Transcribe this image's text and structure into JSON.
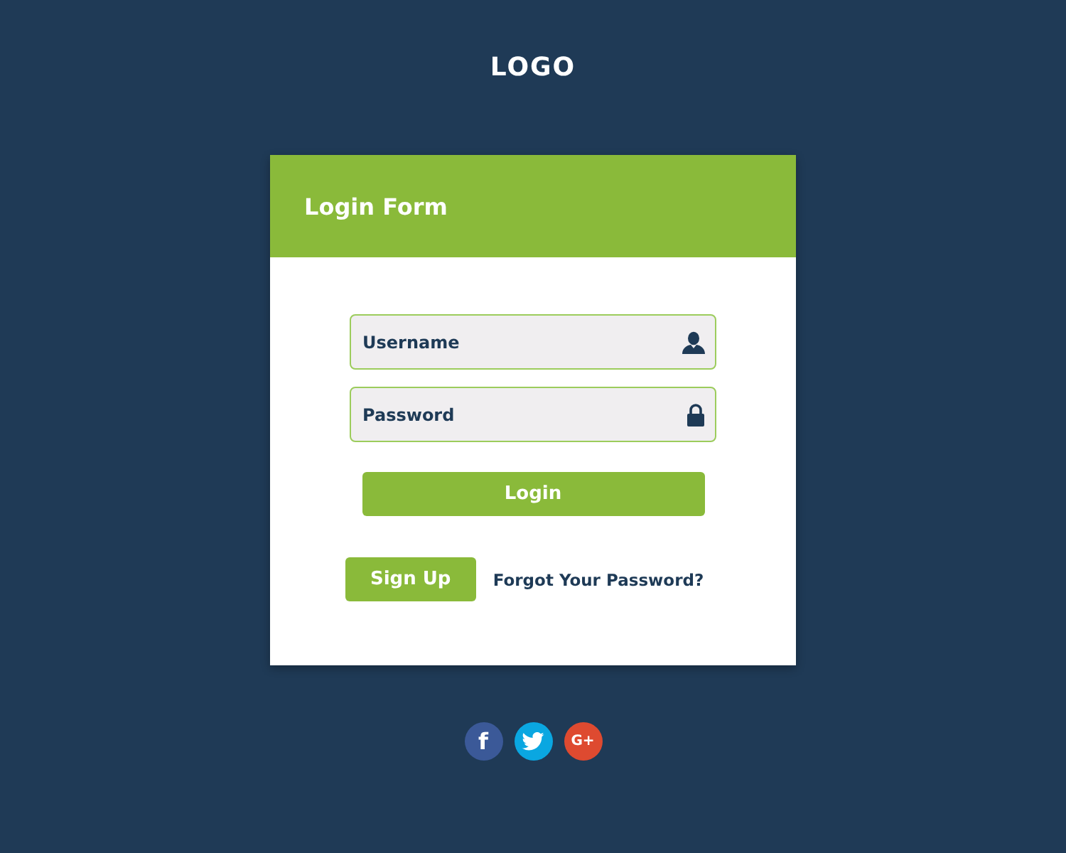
{
  "logo": "LOGO",
  "form": {
    "title": "Login Form",
    "fields": [
      {
        "kind": "text",
        "placeholder": "Username"
      },
      {
        "kind": "password",
        "placeholder": "Password"
      }
    ],
    "login_button": "Login",
    "signup_button": "Sign Up",
    "forgot_link": "Forgot Your Password?"
  },
  "social": [
    {
      "kind": "facebook",
      "label": "f",
      "color": "#3b5998"
    },
    {
      "kind": "twitter",
      "color": "#0aa7e1"
    },
    {
      "kind": "google",
      "label": "G+",
      "color": "#de4a30"
    }
  ]
}
